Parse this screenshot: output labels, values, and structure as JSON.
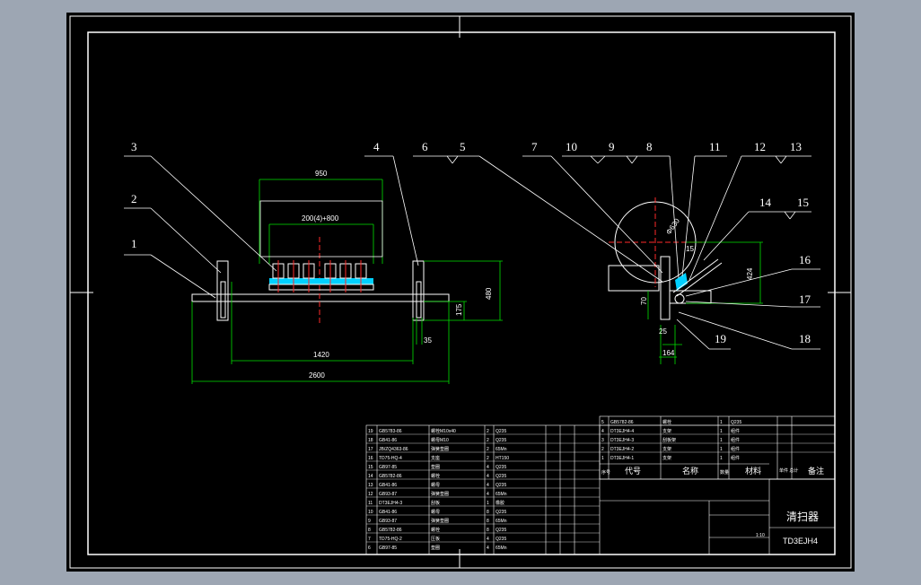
{
  "drawing": {
    "part_name": "清扫器",
    "drawing_number": "TD3EJH4",
    "scale_note": "1:10"
  },
  "balloons": [
    "1",
    "2",
    "3",
    "4",
    "6",
    "5",
    "7",
    "10",
    "9",
    "8",
    "11",
    "12",
    "13",
    "14",
    "15",
    "16",
    "17",
    "18",
    "19"
  ],
  "dimensions": {
    "d950": "950",
    "d2000": "200(4)+800",
    "d1420": "1420",
    "d2600": "2600",
    "d35": "35",
    "d175": "175",
    "d480": "480",
    "d630": "Φ630",
    "d15": "15",
    "d424": "424",
    "d70": "70",
    "d25": "25",
    "d164": "164"
  },
  "title_block": {
    "header_seq": "序号",
    "header_code": "代号",
    "header_name": "名称",
    "header_qty": "数量",
    "header_material": "材料",
    "header_weight": "单件 总计",
    "header_remark": "备注"
  },
  "parts_left": [
    {
      "no": "19",
      "code": "GB5783-86",
      "name": "螺栓M10x40",
      "qty": "2",
      "mat": "Q235"
    },
    {
      "no": "18",
      "code": "GB41-86",
      "name": "螺母M10",
      "qty": "2",
      "mat": "Q235"
    },
    {
      "no": "17",
      "code": "JB/ZQ4363-86",
      "name": "弹簧垫圈",
      "qty": "2",
      "mat": "65Mn"
    },
    {
      "no": "16",
      "code": "TD75-HQ-4",
      "name": "支座",
      "qty": "2",
      "mat": "HT150"
    },
    {
      "no": "15",
      "code": "GB97-85",
      "name": "垫圈",
      "qty": "4",
      "mat": "Q235"
    },
    {
      "no": "14",
      "code": "GB5782-86",
      "name": "螺栓",
      "qty": "4",
      "mat": "Q235"
    },
    {
      "no": "13",
      "code": "GB41-86",
      "name": "螺母",
      "qty": "4",
      "mat": "Q235"
    },
    {
      "no": "12",
      "code": "GB93-87",
      "name": "弹簧垫圈",
      "qty": "4",
      "mat": "65Mn"
    },
    {
      "no": "11",
      "code": "DT3EJH4-3",
      "name": "刮板",
      "qty": "1",
      "mat": "橡胶"
    },
    {
      "no": "10",
      "code": "GB41-86",
      "name": "螺母",
      "qty": "8",
      "mat": "Q235"
    },
    {
      "no": "9",
      "code": "GB93-87",
      "name": "弹簧垫圈",
      "qty": "8",
      "mat": "65Mn"
    },
    {
      "no": "8",
      "code": "GB5782-86",
      "name": "螺栓",
      "qty": "8",
      "mat": "Q235"
    },
    {
      "no": "7",
      "code": "TD75-HQ-2",
      "name": "压板",
      "qty": "4",
      "mat": "Q235"
    },
    {
      "no": "6",
      "code": "GB97-85",
      "name": "垫圈",
      "qty": "4",
      "mat": "65Mn"
    }
  ],
  "parts_right": [
    {
      "no": "5",
      "code": "GB5782-86",
      "name": "螺栓",
      "qty": "1",
      "mat": "Q235"
    },
    {
      "no": "4",
      "code": "DT3EJH4-4",
      "name": "支架",
      "qty": "1",
      "mat": "组件"
    },
    {
      "no": "3",
      "code": "DT3EJH4-3",
      "name": "刮板架",
      "qty": "1",
      "mat": "组件"
    },
    {
      "no": "2",
      "code": "DT3EJH4-2",
      "name": "支架",
      "qty": "1",
      "mat": "组件"
    },
    {
      "no": "1",
      "code": "DT3EJH4-1",
      "name": "支架",
      "qty": "1",
      "mat": "组件"
    }
  ],
  "colors": {
    "line": "#ffffff",
    "dim": "#00e000",
    "center": "#ff2a2a",
    "cyan": "#00d0ff",
    "background": "#000000"
  }
}
